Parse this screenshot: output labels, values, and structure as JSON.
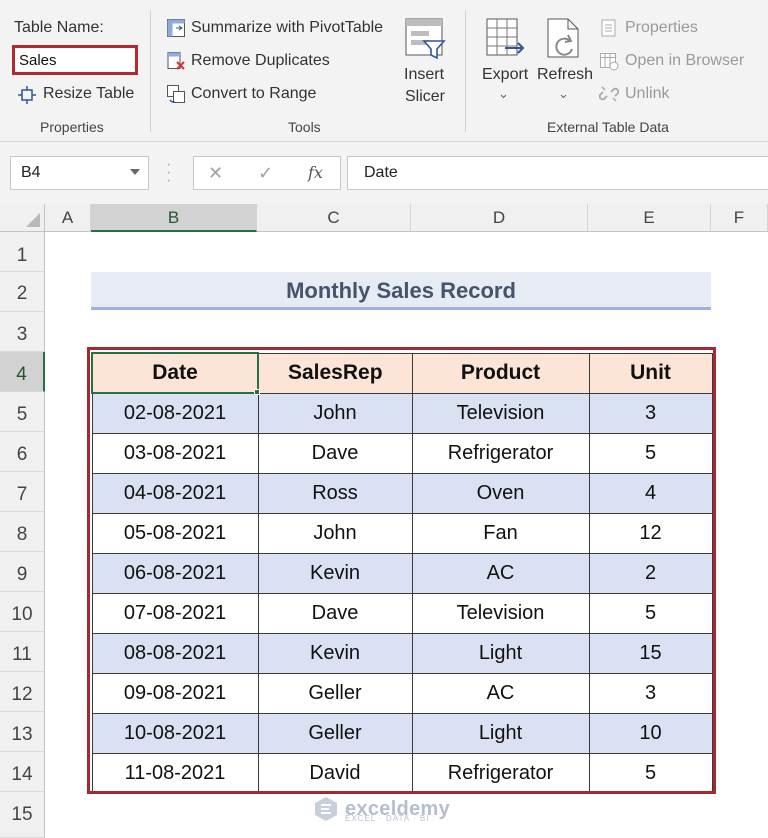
{
  "ribbon": {
    "properties": {
      "table_name_label": "Table Name:",
      "table_name_value": "Sales",
      "resize_label": "Resize Table",
      "group_label": "Properties"
    },
    "tools": {
      "summarize_label": "Summarize with PivotTable",
      "remove_dup_label": "Remove Duplicates",
      "convert_label": "Convert to Range",
      "insert_slicer_line1": "Insert",
      "insert_slicer_line2": "Slicer",
      "group_label": "Tools"
    },
    "external": {
      "export_label": "Export",
      "refresh_label": "Refresh",
      "properties_label": "Properties",
      "open_browser_label": "Open in Browser",
      "unlink_label": "Unlink",
      "group_label": "External Table Data"
    }
  },
  "formula_bar": {
    "name_box": "B4",
    "cancel_glyph": "✕",
    "enter_glyph": "✓",
    "fx_glyph": "fx",
    "formula": "Date"
  },
  "grid": {
    "columns": [
      "A",
      "B",
      "C",
      "D",
      "E",
      "F"
    ],
    "rows": [
      "1",
      "2",
      "3",
      "4",
      "5",
      "6",
      "7",
      "8",
      "9",
      "10",
      "11",
      "12",
      "13",
      "14",
      "15"
    ],
    "selected_col": "B",
    "selected_row": "4"
  },
  "sheet": {
    "title": "Monthly Sales Record",
    "headers": [
      "Date",
      "SalesRep",
      "Product",
      "Unit"
    ],
    "rows": [
      [
        "02-08-2021",
        "John",
        "Television",
        "3"
      ],
      [
        "03-08-2021",
        "Dave",
        "Refrigerator",
        "5"
      ],
      [
        "04-08-2021",
        "Ross",
        "Oven",
        "4"
      ],
      [
        "05-08-2021",
        "John",
        "Fan",
        "12"
      ],
      [
        "06-08-2021",
        "Kevin",
        "AC",
        "2"
      ],
      [
        "07-08-2021",
        "Dave",
        "Television",
        "5"
      ],
      [
        "08-08-2021",
        "Kevin",
        "Light",
        "15"
      ],
      [
        "09-08-2021",
        "Geller",
        "AC",
        "3"
      ],
      [
        "10-08-2021",
        "Geller",
        "Light",
        "10"
      ],
      [
        "11-08-2021",
        "David",
        "Refrigerator",
        "5"
      ]
    ]
  },
  "watermark": {
    "brand": "exceldemy",
    "tagline": "EXCEL · DATA · BI"
  },
  "colors": {
    "accent_green": "#217346",
    "highlight_red": "#a42a30",
    "header_fill": "#fce4d6",
    "band_fill": "#d9e1f2",
    "title_text": "#44546a"
  }
}
